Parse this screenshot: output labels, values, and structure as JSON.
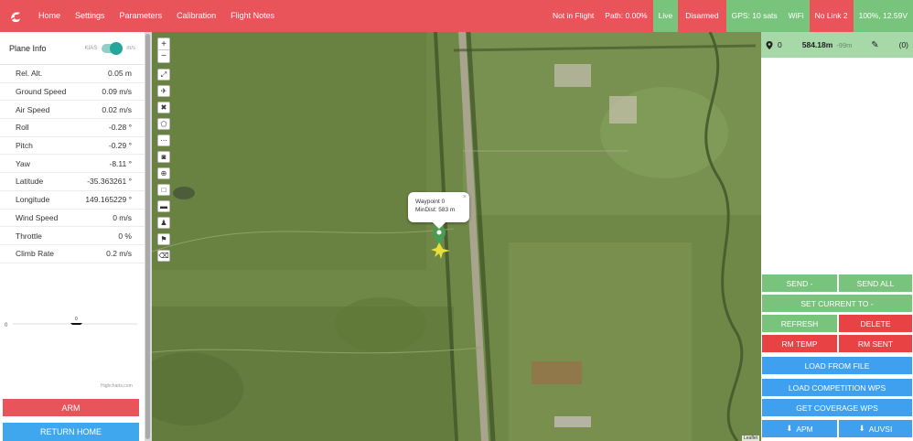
{
  "nav": {
    "logo_icon": "logo-icon",
    "items": [
      "Home",
      "Settings",
      "Parameters",
      "Calibration",
      "Flight Notes"
    ]
  },
  "status": {
    "flight": "Not in Flight",
    "path": "Path: 0.00%",
    "live": "Live",
    "armed": "Disarmed",
    "gps": "GPS: 10 sats",
    "wifi": "WiFi",
    "link": "No Link 2",
    "battery": "100%, 12.59V"
  },
  "colors": {
    "primary_red": "#e9535a",
    "green": "#78c47c",
    "blue": "#3fa0f0"
  },
  "plane_info": {
    "title": "Plane Info",
    "unit_left": "KIAS",
    "unit_right": "m/s",
    "rows": [
      {
        "label": "Rel. Alt.",
        "value": "0.05 m"
      },
      {
        "label": "Ground Speed",
        "value": "0.09 m/s"
      },
      {
        "label": "Air Speed",
        "value": "0.02 m/s"
      },
      {
        "label": "Roll",
        "value": "-0.28 °"
      },
      {
        "label": "Pitch",
        "value": "-0.29 °"
      },
      {
        "label": "Yaw",
        "value": "-8.11 °"
      },
      {
        "label": "Latitude",
        "value": "-35.363261 °"
      },
      {
        "label": "Longitude",
        "value": "149.165229 °"
      },
      {
        "label": "Wind Speed",
        "value": "0 m/s"
      },
      {
        "label": "Throttle",
        "value": "0 %"
      },
      {
        "label": "Climb Rate",
        "value": "0.2 m/s"
      }
    ],
    "chart_axis": "0",
    "chart_point": "0",
    "chart_credit": "Highcharts.com",
    "arm_label": "ARM",
    "return_label": "RETURN HOME"
  },
  "map": {
    "zoom_in": "+",
    "zoom_out": "−",
    "popup_title": "Waypoint 0",
    "popup_dist": "MinDist: 583 m",
    "popup_close": "×",
    "attribution": "Leaflet",
    "tools": [
      "measure-icon",
      "plane-icon",
      "close-icon",
      "polygon-icon",
      "dots-icon",
      "camera-icon",
      "crosshair-icon",
      "square-icon",
      "minus-box-icon",
      "people-icon",
      "flag-icon",
      "eraser-icon"
    ]
  },
  "waypoint_panel": {
    "index": "0",
    "distance": "584.18m",
    "delta": "-99m",
    "count": "(0)",
    "buttons": {
      "send": "SEND -",
      "send_all": "SEND ALL",
      "set_current": "SET CURRENT TO -",
      "refresh": "REFRESH",
      "delete": "DELETE",
      "rm_temp": "RM TEMP",
      "rm_sent": "RM SENT",
      "load_file": "LOAD FROM FILE",
      "load_comp": "LOAD COMPETITION WPS",
      "coverage": "GET COVERAGE WPS",
      "apm": "APM",
      "auvsi": "AUVSI"
    }
  }
}
